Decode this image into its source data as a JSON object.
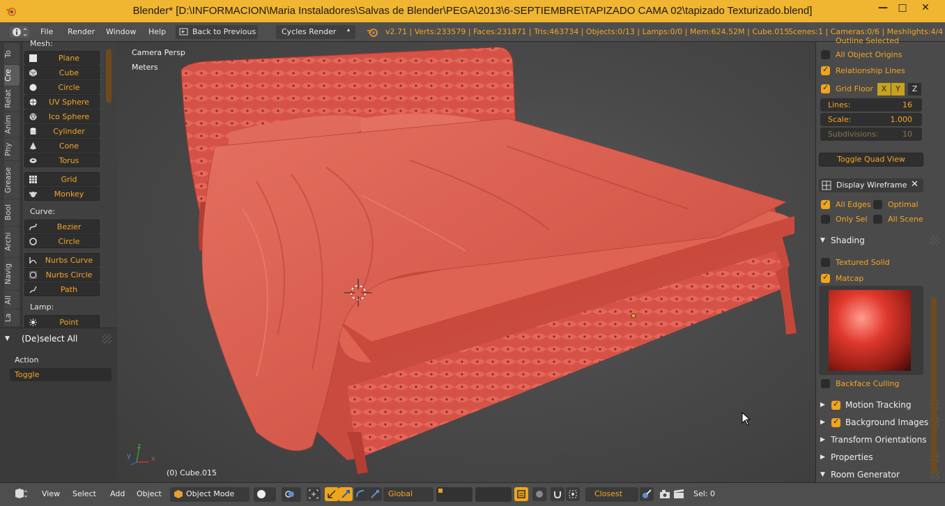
{
  "window": {
    "title": "Blender* [D:\\INFORMACION\\Maria Instaladores\\Salvas de Blender\\PEGA\\2013\\6-SEPTIEMBRE\\TAPIZADO CAMA 02\\tapizado Texturizado.blend]",
    "min": "—",
    "max": "□",
    "close": "✕"
  },
  "infobar": {
    "menus": [
      "File",
      "Render",
      "Window",
      "Help"
    ],
    "back_label": "Back to Previous",
    "engine": "Cycles Render",
    "stats": "v2.71 | Verts:233579 | Faces:231871 | Tris:463734 | Objects:0/13 | Lamps:0/0 | Mem:624.52M | Cube.015",
    "scene_stats": "Scenes:1 | Cameras:0/6 | Meshlights:4/4"
  },
  "toolshelf": {
    "tabs": [
      "To",
      "Cre",
      "Relat",
      "Anim",
      "Phy",
      "Grease",
      "Bool",
      "Archi",
      "Navig",
      "All",
      "La"
    ],
    "mesh_label": "Mesh:",
    "mesh_items": [
      "Plane",
      "Cube",
      "Circle",
      "UV Sphere",
      "Ico Sphere",
      "Cylinder",
      "Cone",
      "Torus"
    ],
    "mesh_items2": [
      "Grid",
      "Monkey"
    ],
    "curve_label": "Curve:",
    "curve_items": [
      "Bezier",
      "Circle"
    ],
    "curve_items2": [
      "Nurbs Curve",
      "Nurbs Circle",
      "Path"
    ],
    "lamp_label": "Lamp:",
    "lamp_items": [
      "Point"
    ]
  },
  "operator": {
    "title": "(De)select All",
    "action_label": "Action",
    "action_value": "Toggle"
  },
  "viewport": {
    "view_name": "Camera Persp",
    "units": "Meters",
    "object_info": "(0) Cube.015",
    "axis_x": "x",
    "axis_y": "y",
    "axis_z": "z"
  },
  "npanel": {
    "outline_partial": "Outline Selected",
    "all_object_origins": "All Object Origins",
    "relationship_lines": "Relationship Lines",
    "grid_floor": "Grid Floor",
    "axes": [
      "X",
      "Y",
      "Z"
    ],
    "lines_label": "Lines:",
    "lines_value": "16",
    "scale_label": "Scale:",
    "scale_value": "1.000",
    "subdiv_label": "Subdivisions:",
    "subdiv_value": "10",
    "toggle_quad": "Toggle Quad View",
    "display_wireframe": "Display Wireframe",
    "all_edges": "All Edges",
    "optimal": "Optimal",
    "only_sel": "Only Sel",
    "all_scene": "All Scene",
    "shading": "Shading",
    "textured_solid": "Textured Solid",
    "matcap": "Matcap",
    "backface": "Backface Culling",
    "motion_tracking": "Motion Tracking",
    "background_images": "Background Images",
    "transform_orientations": "Transform Orientations",
    "properties": "Properties",
    "room_generator": "Room Generator",
    "checks": {
      "outline_selected": false,
      "all_object_origins": false,
      "relationship_lines": true,
      "grid_floor": true,
      "all_edges": true,
      "optimal": false,
      "only_sel": false,
      "all_scene": false,
      "textured_solid": false,
      "matcap": true,
      "backface": false,
      "motion_tracking": true,
      "background_images": true
    }
  },
  "bottombar": {
    "menus": [
      "View",
      "Select",
      "Add",
      "Object"
    ],
    "mode": "Object Mode",
    "orientation": "Global",
    "snap": "Closest",
    "sel": "Sel: 0"
  },
  "colors": {
    "accent": "#f0b531",
    "text_orange": "#f5a623",
    "bed": "#d9584a"
  }
}
